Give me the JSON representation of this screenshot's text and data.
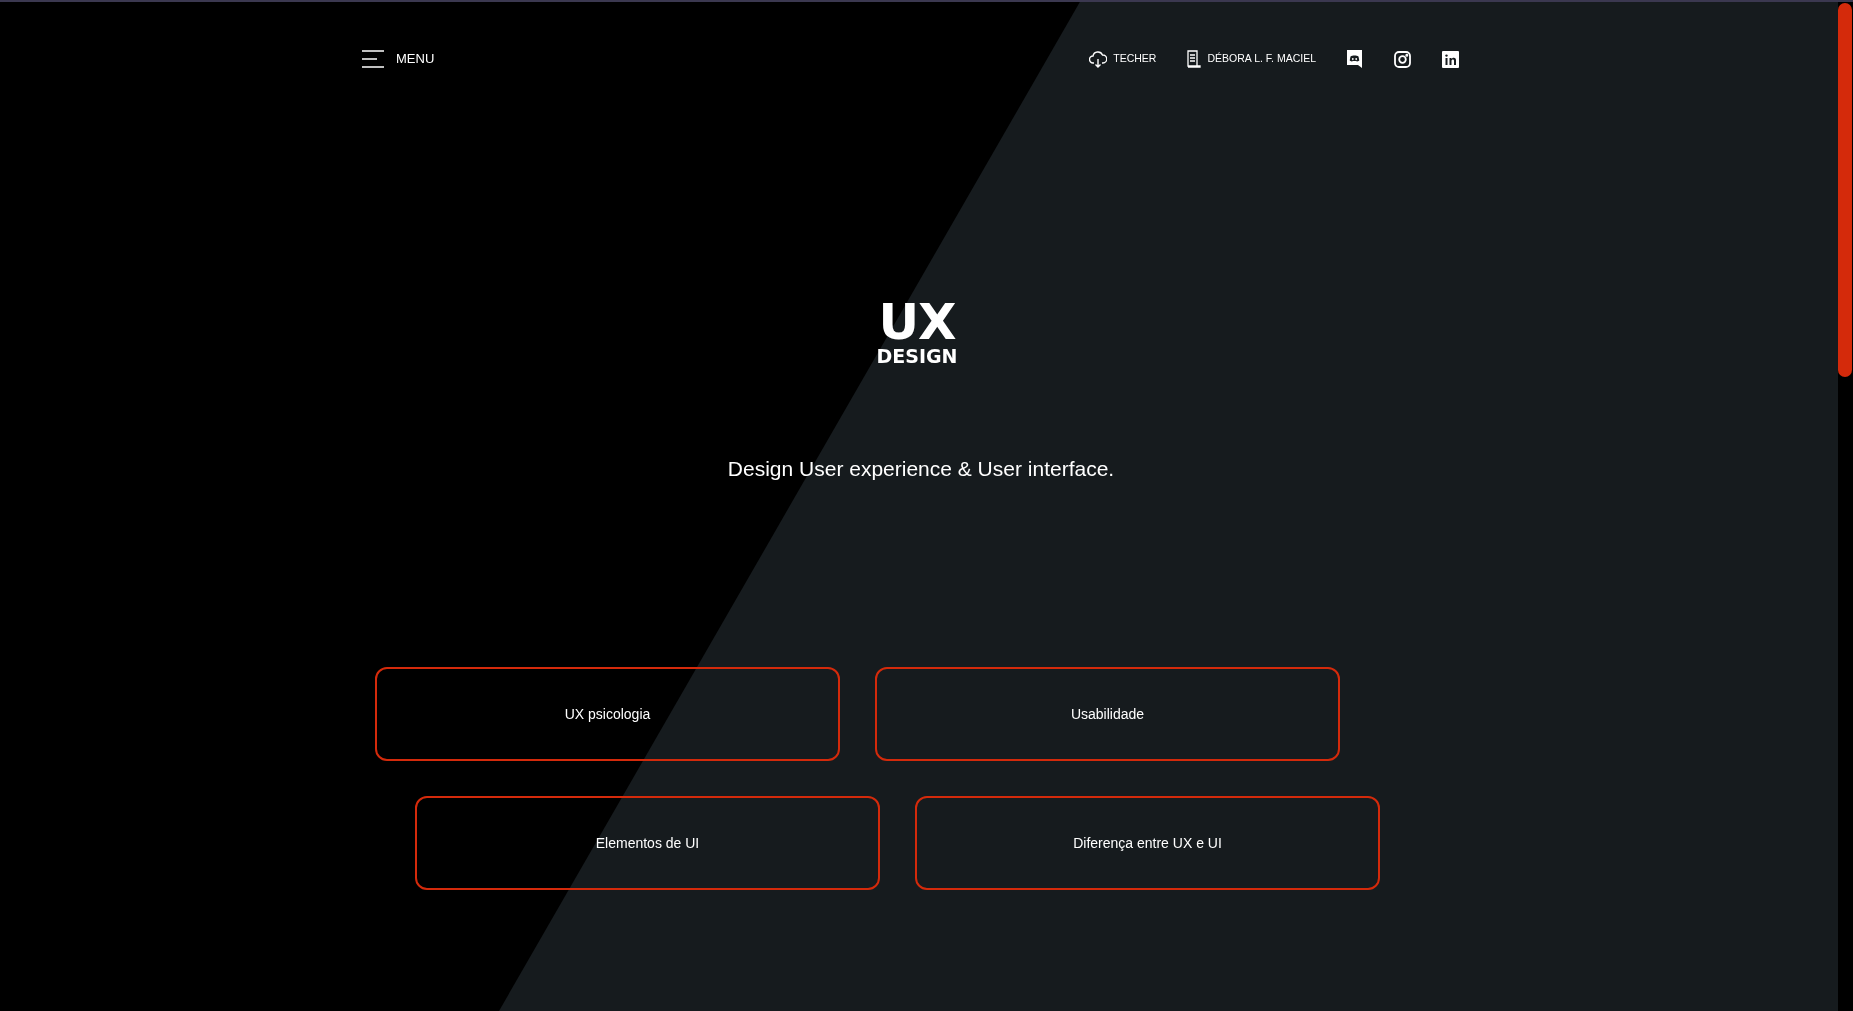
{
  "header": {
    "menu_label": "MENU",
    "links": [
      {
        "kind": "download",
        "label": "TECHER"
      },
      {
        "kind": "document",
        "label": "DÉBORA L. F. MACIEL"
      }
    ],
    "social": [
      {
        "kind": "discord"
      },
      {
        "kind": "instagram"
      },
      {
        "kind": "linkedin"
      }
    ]
  },
  "logo": {
    "title": "UX",
    "subtitle": "DESIGN"
  },
  "tagline": "Design User experience & User interface.",
  "cards": [
    {
      "label": "UX psicologia"
    },
    {
      "label": "Usabilidade"
    },
    {
      "label": "Elementos de UI"
    },
    {
      "label": "Diferença entre UX e UI"
    }
  ]
}
